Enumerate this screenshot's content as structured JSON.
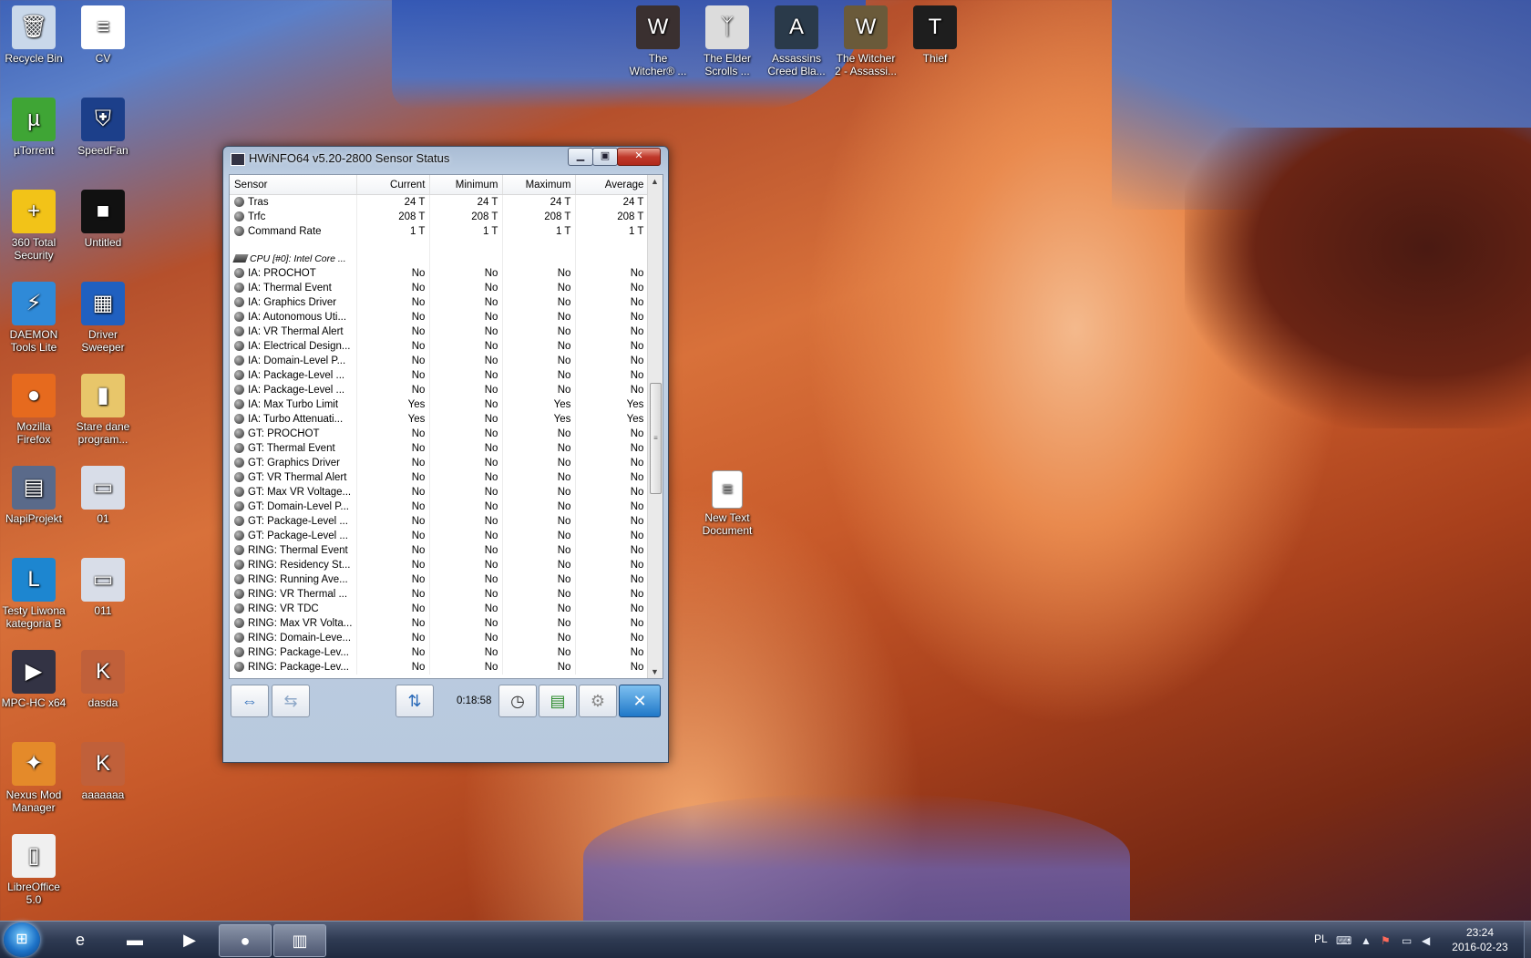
{
  "desktop_icons": [
    {
      "label": "Recycle Bin",
      "icon": "recycle-bin-icon",
      "shortcut": false,
      "color": "#c9d8ea",
      "glyph": "🗑"
    },
    {
      "label": "CV",
      "icon": "document-icon",
      "shortcut": false,
      "color": "#ffffff",
      "glyph": "≡"
    },
    {
      "label": "µTorrent",
      "icon": "utorrent-icon",
      "shortcut": true,
      "color": "#3fa535",
      "glyph": "µ"
    },
    {
      "label": "SpeedFan",
      "icon": "speedfan-icon",
      "shortcut": true,
      "color": "#1c3f8a",
      "glyph": "⛨"
    },
    {
      "label": "360 Total Security",
      "icon": "security-icon",
      "shortcut": false,
      "color": "#f2c318",
      "glyph": "+"
    },
    {
      "label": "Untitled",
      "icon": "image-icon",
      "shortcut": false,
      "color": "#111111",
      "glyph": "■"
    },
    {
      "label": "DAEMON Tools Lite",
      "icon": "daemon-tools-icon",
      "shortcut": true,
      "color": "#2f8ad8",
      "glyph": "⚡"
    },
    {
      "label": "Driver Sweeper",
      "icon": "driver-sweeper-icon",
      "shortcut": true,
      "color": "#2060c0",
      "glyph": "▦"
    },
    {
      "label": "Mozilla Firefox",
      "icon": "firefox-icon",
      "shortcut": true,
      "color": "#e66a1e",
      "glyph": "●"
    },
    {
      "label": "Stare dane program...",
      "icon": "folder-icon",
      "shortcut": false,
      "color": "#e8c66a",
      "glyph": "▮"
    },
    {
      "label": "NapiProjekt",
      "icon": "napiprojekt-icon",
      "shortcut": true,
      "color": "#5a6a8a",
      "glyph": "▤"
    },
    {
      "label": "01",
      "icon": "screenshot-icon",
      "shortcut": false,
      "color": "#d8dde8",
      "glyph": "▭"
    },
    {
      "label": "Testy Liwona kategoria B",
      "icon": "testy-icon",
      "shortcut": true,
      "color": "#1d86d0",
      "glyph": "L"
    },
    {
      "label": "011",
      "icon": "screenshot-icon",
      "shortcut": false,
      "color": "#d8dde8",
      "glyph": "▭"
    },
    {
      "label": "MPC-HC x64",
      "icon": "mpc-hc-icon",
      "shortcut": true,
      "color": "#334",
      "glyph": "▶"
    },
    {
      "label": "dasda",
      "icon": "image-icon",
      "shortcut": true,
      "color": "#c0603a",
      "glyph": "K"
    },
    {
      "label": "Nexus Mod Manager",
      "icon": "nexus-icon",
      "shortcut": true,
      "color": "#e48a2a",
      "glyph": "✦"
    },
    {
      "label": "aaaaaaa",
      "icon": "image-icon",
      "shortcut": true,
      "color": "#c0603a",
      "glyph": "K"
    },
    {
      "label": "LibreOffice 5.0",
      "icon": "libreoffice-icon",
      "shortcut": true,
      "color": "#f0f0f0",
      "glyph": "▯"
    }
  ],
  "top_icons": [
    {
      "label": "The Witcher® ...",
      "icon": "witcher-icon",
      "color": "#3a3030",
      "glyph": "W"
    },
    {
      "label": "The Elder Scrolls ...",
      "icon": "skyrim-icon",
      "color": "#dcdcdc",
      "glyph": "ᛉ"
    },
    {
      "label": "Assassins Creed Bla...",
      "icon": "assassins-creed-icon",
      "color": "#2a3a4a",
      "glyph": "A"
    },
    {
      "label": "The Witcher 2 - Assassi...",
      "icon": "witcher2-icon",
      "color": "#6a5a3a",
      "glyph": "W"
    },
    {
      "label": "Thief",
      "icon": "thief-icon",
      "color": "#1e1e1e",
      "glyph": "T"
    }
  ],
  "floating_icon": {
    "label": "New Text Document",
    "icon": "text-document-icon",
    "glyph": "≡"
  },
  "window": {
    "title": "HWiNFO64 v5.20-2800 Sensor Status",
    "min_label": "▁",
    "max_label": "▣",
    "close_label": "✕",
    "columns": [
      "Sensor",
      "Current",
      "Minimum",
      "Maximum",
      "Average"
    ],
    "rows": [
      {
        "type": "row",
        "name": "Tras",
        "current": "24 T",
        "minimum": "24 T",
        "maximum": "24 T",
        "average": "24 T"
      },
      {
        "type": "row",
        "name": "Trfc",
        "current": "208 T",
        "minimum": "208 T",
        "maximum": "208 T",
        "average": "208 T"
      },
      {
        "type": "row",
        "name": "Command Rate",
        "current": "1 T",
        "minimum": "1 T",
        "maximum": "1 T",
        "average": "1 T"
      },
      {
        "type": "blank"
      },
      {
        "type": "group",
        "name": "CPU [#0]: Intel Core ..."
      },
      {
        "type": "row",
        "name": "IA: PROCHOT",
        "current": "No",
        "minimum": "No",
        "maximum": "No",
        "average": "No"
      },
      {
        "type": "row",
        "name": "IA: Thermal Event",
        "current": "No",
        "minimum": "No",
        "maximum": "No",
        "average": "No"
      },
      {
        "type": "row",
        "name": "IA: Graphics Driver",
        "current": "No",
        "minimum": "No",
        "maximum": "No",
        "average": "No"
      },
      {
        "type": "row",
        "name": "IA: Autonomous Uti...",
        "current": "No",
        "minimum": "No",
        "maximum": "No",
        "average": "No"
      },
      {
        "type": "row",
        "name": "IA: VR Thermal Alert",
        "current": "No",
        "minimum": "No",
        "maximum": "No",
        "average": "No"
      },
      {
        "type": "row",
        "name": "IA: Electrical Design...",
        "current": "No",
        "minimum": "No",
        "maximum": "No",
        "average": "No"
      },
      {
        "type": "row",
        "name": "IA: Domain-Level P...",
        "current": "No",
        "minimum": "No",
        "maximum": "No",
        "average": "No"
      },
      {
        "type": "row",
        "name": "IA: Package-Level ...",
        "current": "No",
        "minimum": "No",
        "maximum": "No",
        "average": "No"
      },
      {
        "type": "row",
        "name": "IA: Package-Level ...",
        "current": "No",
        "minimum": "No",
        "maximum": "No",
        "average": "No"
      },
      {
        "type": "row",
        "name": "IA: Max Turbo Limit",
        "current": "Yes",
        "minimum": "No",
        "maximum": "Yes",
        "average": "Yes"
      },
      {
        "type": "row",
        "name": "IA: Turbo Attenuati...",
        "current": "Yes",
        "minimum": "No",
        "maximum": "Yes",
        "average": "Yes"
      },
      {
        "type": "row",
        "name": "GT: PROCHOT",
        "current": "No",
        "minimum": "No",
        "maximum": "No",
        "average": "No"
      },
      {
        "type": "row",
        "name": "GT: Thermal Event",
        "current": "No",
        "minimum": "No",
        "maximum": "No",
        "average": "No"
      },
      {
        "type": "row",
        "name": "GT: Graphics Driver",
        "current": "No",
        "minimum": "No",
        "maximum": "No",
        "average": "No"
      },
      {
        "type": "row",
        "name": "GT: VR Thermal Alert",
        "current": "No",
        "minimum": "No",
        "maximum": "No",
        "average": "No"
      },
      {
        "type": "row",
        "name": "GT: Max VR Voltage...",
        "current": "No",
        "minimum": "No",
        "maximum": "No",
        "average": "No"
      },
      {
        "type": "row",
        "name": "GT: Domain-Level P...",
        "current": "No",
        "minimum": "No",
        "maximum": "No",
        "average": "No"
      },
      {
        "type": "row",
        "name": "GT: Package-Level ...",
        "current": "No",
        "minimum": "No",
        "maximum": "No",
        "average": "No"
      },
      {
        "type": "row",
        "name": "GT: Package-Level ...",
        "current": "No",
        "minimum": "No",
        "maximum": "No",
        "average": "No"
      },
      {
        "type": "row",
        "name": "RING: Thermal Event",
        "current": "No",
        "minimum": "No",
        "maximum": "No",
        "average": "No"
      },
      {
        "type": "row",
        "name": "RING: Residency St...",
        "current": "No",
        "minimum": "No",
        "maximum": "No",
        "average": "No"
      },
      {
        "type": "row",
        "name": "RING: Running Ave...",
        "current": "No",
        "minimum": "No",
        "maximum": "No",
        "average": "No"
      },
      {
        "type": "row",
        "name": "RING: VR Thermal ...",
        "current": "No",
        "minimum": "No",
        "maximum": "No",
        "average": "No"
      },
      {
        "type": "row",
        "name": "RING: VR TDC",
        "current": "No",
        "minimum": "No",
        "maximum": "No",
        "average": "No"
      },
      {
        "type": "row",
        "name": "RING: Max VR Volta...",
        "current": "No",
        "minimum": "No",
        "maximum": "No",
        "average": "No"
      },
      {
        "type": "row",
        "name": "RING: Domain-Leve...",
        "current": "No",
        "minimum": "No",
        "maximum": "No",
        "average": "No"
      },
      {
        "type": "row",
        "name": "RING: Package-Lev...",
        "current": "No",
        "minimum": "No",
        "maximum": "No",
        "average": "No"
      },
      {
        "type": "row",
        "name": "RING: Package-Lev...",
        "current": "No",
        "minimum": "No",
        "maximum": "No",
        "average": "No"
      }
    ],
    "toolbar": {
      "expand_icon": "⇔",
      "collapse_icon": "⇆",
      "network_icon": "⇅",
      "timer": "0:18:58",
      "clock_icon": "◷",
      "log_icon": "▤",
      "settings_icon": "⚙",
      "close_icon": "✕"
    }
  },
  "taskbar": {
    "start_glyph": "⊞",
    "apps": [
      {
        "name": "internet-explorer",
        "glyph": "e",
        "active": false
      },
      {
        "name": "file-explorer",
        "glyph": "▬",
        "active": false
      },
      {
        "name": "media-player",
        "glyph": "▶",
        "active": false
      },
      {
        "name": "firefox",
        "glyph": "●",
        "active": true
      },
      {
        "name": "hwinfo",
        "glyph": "▥",
        "active": true
      }
    ],
    "language": "PL",
    "time": "23:24",
    "date": "2016-02-23"
  }
}
